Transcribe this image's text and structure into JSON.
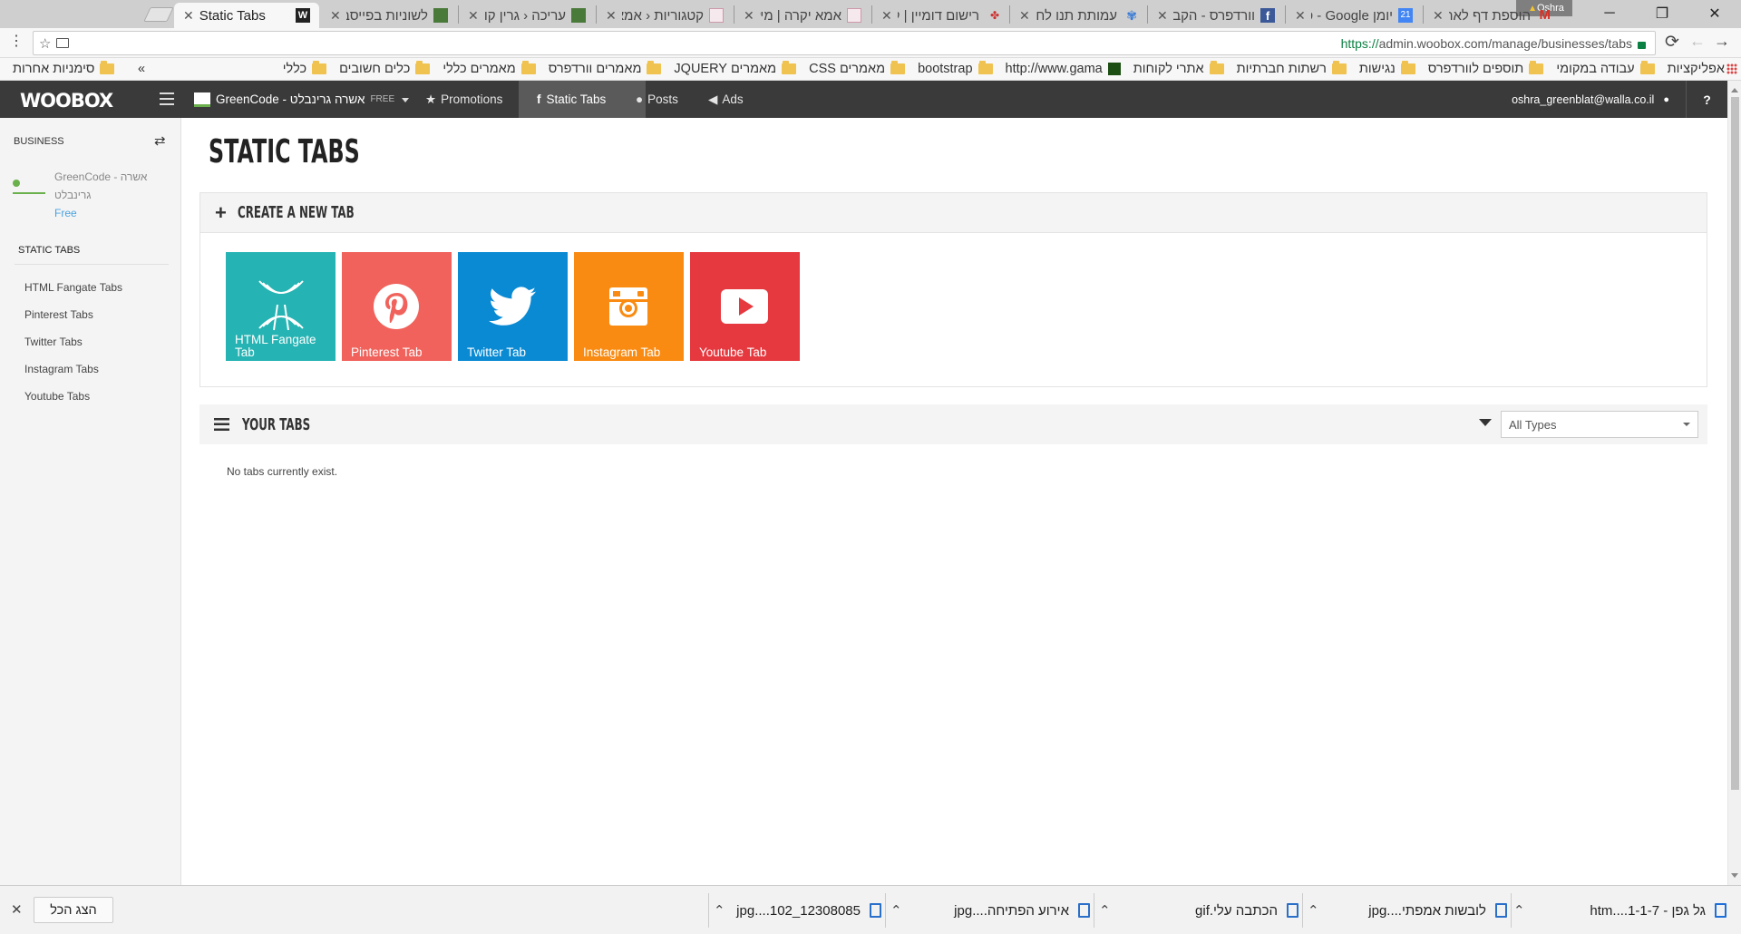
{
  "browser": {
    "tabs": [
      {
        "title": "Static Tabs",
        "active": true
      },
      {
        "title": "לשוניות בפייסבוק"
      },
      {
        "title": "עריכה ‹ גרין קוד"
      },
      {
        "title": "קטגוריות ‹ אמא"
      },
      {
        "title": "אמא יקרה | מיזם"
      },
      {
        "title": "רישום דומיין | קו"
      },
      {
        "title": "עמותת תנו לחיו"
      },
      {
        "title": "וורדפרס - הקבוצה"
      },
      {
        "title": "יומן Google - פ"
      },
      {
        "title": "הוספת דף לאתר"
      }
    ],
    "profile": "Oshra",
    "url_scheme": "https://",
    "url_rest": "admin.woobox.com/manage/businesses/tabs",
    "bookmarks": [
      "אפליקציות",
      "עבודה במקומי",
      "תוספים לוורדפרס",
      "נגישות",
      "רשתות חברתיות",
      "אתרי לקוחות",
      "http://www.gama",
      "bootstrap",
      "מאמרים CSS",
      "מאמרים JQUERY",
      "מאמרים וורדפרס",
      "מאמרים כללי",
      "כלים חשובים",
      "כללי"
    ],
    "bookmarks_more": "»",
    "other_bookmarks": "סימניות אחרות"
  },
  "topnav": {
    "logo": "WOOBOX",
    "business": "GreenCode - אשרה גרינבלט",
    "plan": "FREE",
    "items": [
      {
        "label": "Promotions"
      },
      {
        "label": "Static Tabs",
        "active": true
      },
      {
        "label": "Posts"
      },
      {
        "label": "Ads"
      }
    ],
    "user_email": "oshra_greenblat@walla.co.il",
    "help": "?"
  },
  "sidebar": {
    "business_heading": "BUSINESS",
    "business_name_line1": "GreenCode - אשרה",
    "business_name_line2": "גרינבלט",
    "business_plan": "Free",
    "section_heading": "STATIC TABS",
    "links": [
      "HTML Fangate Tabs",
      "Pinterest Tabs",
      "Twitter Tabs",
      "Instagram Tabs",
      "Youtube Tabs"
    ]
  },
  "main": {
    "page_title": "STATIC TABS",
    "create_heading": "CREATE A NEW TAB",
    "tiles": [
      {
        "line1": "HTML Fangate",
        "line2": "Tab",
        "color": "#26b3b3"
      },
      {
        "line1": "Pinterest Tab",
        "line2": "",
        "color": "#f0625b"
      },
      {
        "line1": "Twitter Tab",
        "line2": "",
        "color": "#0a8ad3"
      },
      {
        "line1": "Instagram Tab",
        "line2": "",
        "color": "#f98b12"
      },
      {
        "line1": "Youtube Tab",
        "line2": "",
        "color": "#e5393f"
      }
    ],
    "your_tabs_heading": "YOUR TABS",
    "filter_value": "All Types",
    "empty_message": "No tabs currently exist."
  },
  "downloads": {
    "items": [
      "12308085_102....jpg",
      "אירוע הפתיחה....jpg",
      "הכתבה עלי.gif",
      "לובשות אמפתי....jpg",
      "גל גפן - 1-1-7....htm"
    ],
    "show_all": "הצג הכל"
  }
}
